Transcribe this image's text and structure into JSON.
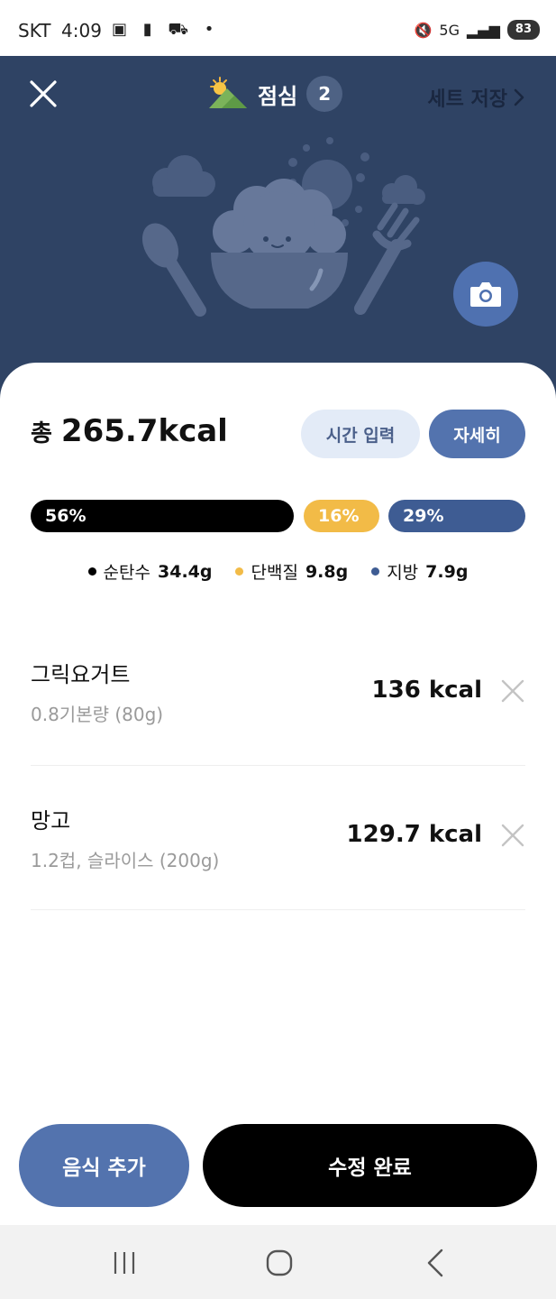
{
  "status_bar": {
    "carrier": "SKT",
    "time": "4:09",
    "network": "5G",
    "battery": "83"
  },
  "header": {
    "meal_title": "점심",
    "meal_count": "2",
    "set_save_label": "세트 저장",
    "icons": [
      "close-icon",
      "sun-cloud-icon",
      "chevron-right-icon",
      "camera-icon"
    ]
  },
  "summary": {
    "total_prefix": "총",
    "total_kcal": "265.7kcal",
    "time_input_label": "시간 입력",
    "detail_label": "자세히"
  },
  "macros": {
    "bar": [
      {
        "key": "carb",
        "percent_label": "56%",
        "fraction": 0.56,
        "color": "#000000"
      },
      {
        "key": "protein",
        "percent_label": "16%",
        "fraction": 0.16,
        "color": "#f2bb47"
      },
      {
        "key": "fat",
        "percent_label": "29%",
        "fraction": 0.29,
        "color": "#3e5c93"
      }
    ],
    "legend": [
      {
        "label": "순탄수",
        "value": "34.4g",
        "color": "#000000"
      },
      {
        "label": "단백질",
        "value": "9.8g",
        "color": "#f2bb47"
      },
      {
        "label": "지방",
        "value": "7.9g",
        "color": "#3e5c93"
      }
    ]
  },
  "foods": [
    {
      "name": "그릭요거트",
      "portion": "0.8기본량 (80g)",
      "kcal": "136 kcal"
    },
    {
      "name": "망고",
      "portion": "1.2컵, 슬라이스 (200g)",
      "kcal": "129.7 kcal"
    }
  ],
  "actions": {
    "add_food_label": "음식 추가",
    "done_label": "수정 완료"
  },
  "colors": {
    "header_bg": "#2f4364",
    "accent_blue": "#5373ae",
    "light_blue": "#e3ebf7"
  }
}
